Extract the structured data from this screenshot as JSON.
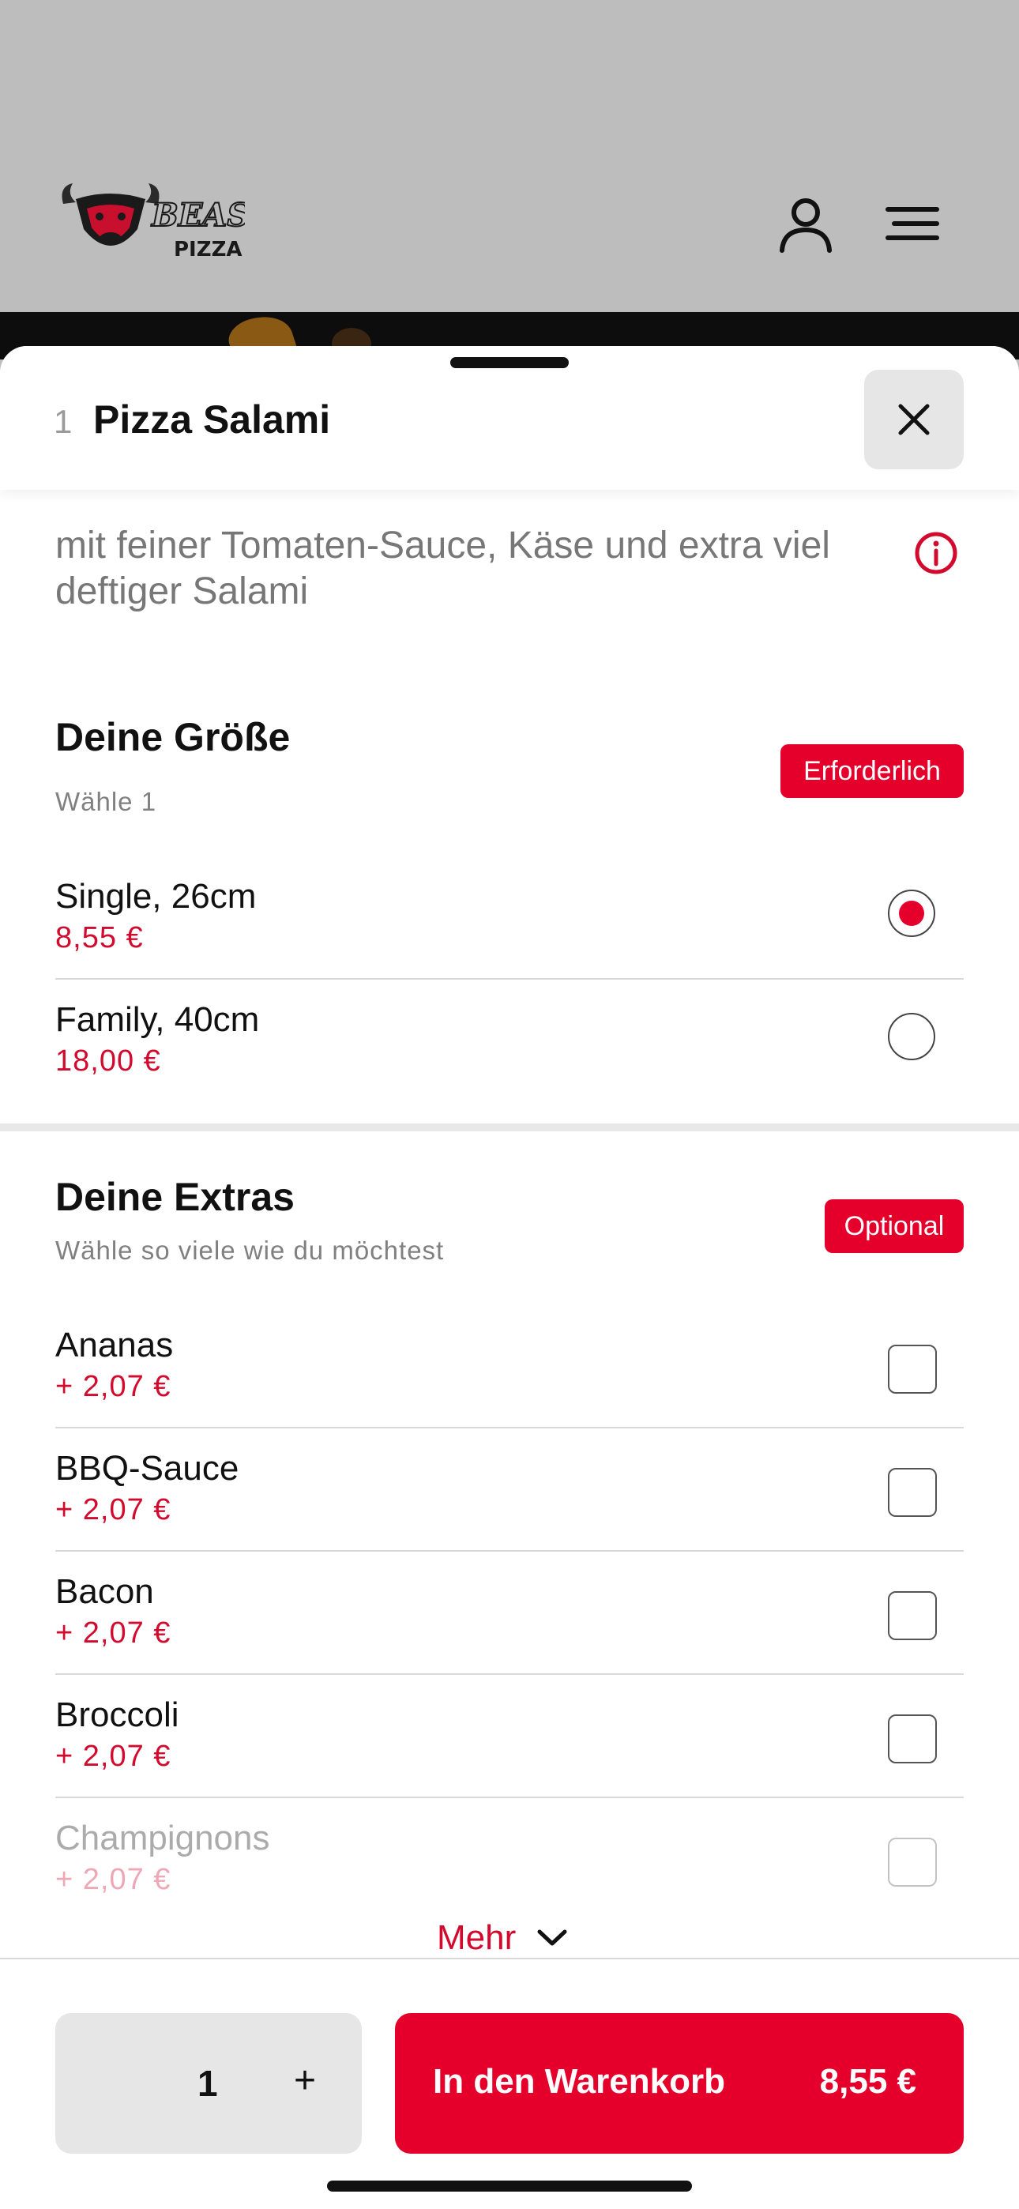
{
  "header": {
    "logo_text": "BEAST PIZZA",
    "icons": [
      "user-icon",
      "hamburger-menu-icon"
    ]
  },
  "sheet": {
    "qty": "1",
    "title": "Pizza Salami",
    "close_icon": "close-icon",
    "description": "mit feiner Tomaten-Sauce, Käse und extra viel deftiger Salami",
    "info_icon": "info-icon"
  },
  "size": {
    "title": "Deine Größe",
    "subtitle": "Wähle 1",
    "badge": "Erforderlich",
    "options": [
      {
        "name": "Single, 26cm",
        "price": "8,55 €",
        "selected": true
      },
      {
        "name": "Family, 40cm",
        "price": "18,00 €",
        "selected": false
      }
    ]
  },
  "extras": {
    "title": "Deine Extras",
    "subtitle": "Wähle so viele wie du möchtest",
    "badge": "Optional",
    "items": [
      {
        "name": "Ananas",
        "price": "+ 2,07 €",
        "checked": false
      },
      {
        "name": "BBQ-Sauce",
        "price": "+ 2,07 €",
        "checked": false
      },
      {
        "name": "Bacon",
        "price": "+ 2,07 €",
        "checked": false
      },
      {
        "name": "Broccoli",
        "price": "+ 2,07 €",
        "checked": false
      },
      {
        "name": "Champignons",
        "price": "+ 2,07 €",
        "checked": false
      }
    ],
    "more_label": "Mehr"
  },
  "footer": {
    "quantity": "1",
    "plus_label": "+",
    "cart_label": "In den Warenkorb",
    "cart_price": "8,55 €"
  },
  "colors": {
    "accent": "#e4002b",
    "price": "#d10a2e",
    "background": "#bdbdbd"
  }
}
